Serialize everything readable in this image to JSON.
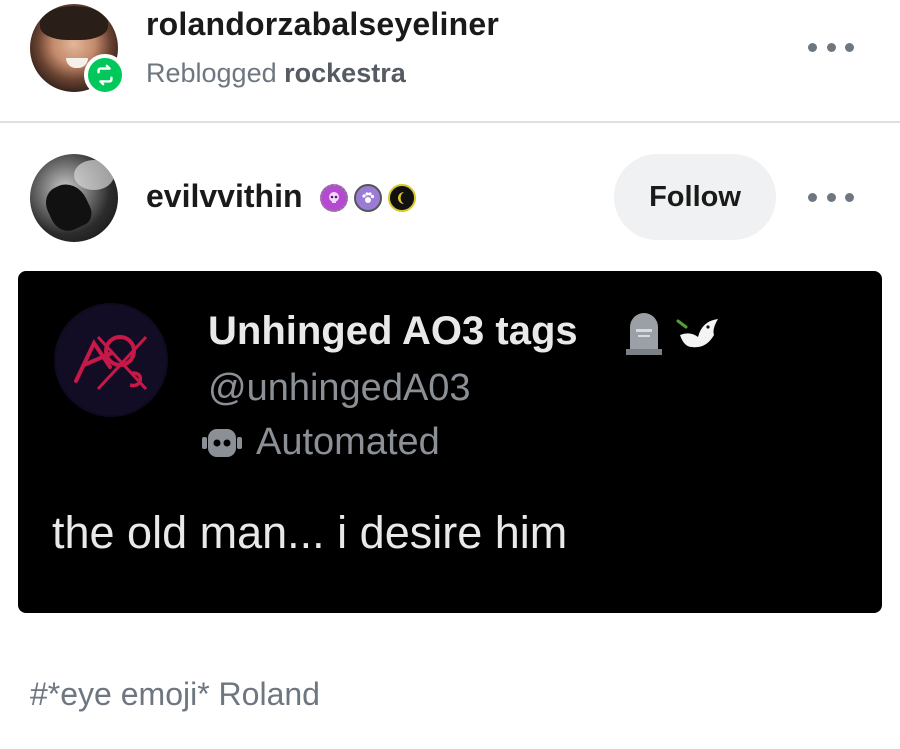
{
  "reblog": {
    "username": "rolandorzabalseyeliner",
    "reblogged_prefix": "Reblogged",
    "reblogged_from": "rockestra"
  },
  "post": {
    "username": "evilvvithin",
    "follow_label": "Follow"
  },
  "tweet": {
    "display_name": "Unhinged AO3 tags",
    "handle": "@unhingedA03",
    "automated_label": "Automated",
    "text": "the old man... i desire him"
  },
  "tags": {
    "tag_text": "#*eye emoji* Roland"
  },
  "colors": {
    "reblog_green": "#00c85a",
    "muted_text": "#6e7680",
    "follow_bg": "#f0f1f2",
    "tweet_bg": "#000000"
  },
  "icons": {
    "reblog": "reblog-icon",
    "more": "more-options-icon",
    "badges": [
      "skull-badge-icon",
      "paw-badge-icon",
      "moon-badge-icon"
    ],
    "tweet_emojis": [
      "headstone-icon",
      "dove-icon"
    ],
    "automated": "robot-icon"
  }
}
